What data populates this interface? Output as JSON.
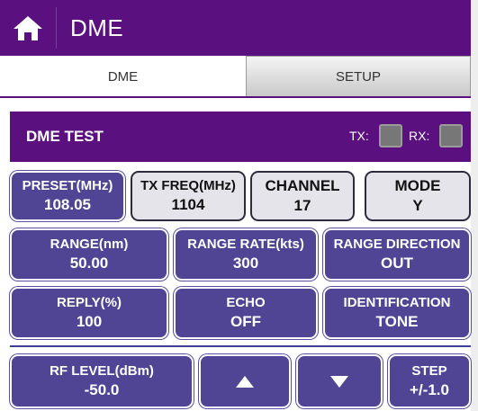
{
  "app": {
    "title": "DME"
  },
  "tabs": [
    {
      "label": "DME",
      "active": true
    },
    {
      "label": "SETUP",
      "active": false
    }
  ],
  "panel": {
    "title": "DME TEST",
    "tx_label": "TX:",
    "rx_label": "RX:"
  },
  "params": {
    "preset": {
      "label": "PRESET(MHz)",
      "value": "108.05"
    },
    "tx_freq": {
      "label": "TX FREQ(MHz)",
      "value": "1104"
    },
    "channel": {
      "label": "CHANNEL",
      "value": "17"
    },
    "mode": {
      "label": "MODE",
      "value": "Y"
    },
    "range": {
      "label": "RANGE(nm)",
      "value": "50.00"
    },
    "range_rate": {
      "label": "RANGE RATE(kts)",
      "value": "300"
    },
    "range_direction": {
      "label": "RANGE DIRECTION",
      "value": "OUT"
    },
    "reply": {
      "label": "REPLY(%)",
      "value": "100"
    },
    "echo": {
      "label": "ECHO",
      "value": "OFF"
    },
    "identification": {
      "label": "IDENTIFICATION",
      "value": "TONE"
    },
    "rf_level": {
      "label": "RF LEVEL(dBm)",
      "value": "-50.0"
    },
    "step": {
      "label": "STEP",
      "value": "+/-1.0"
    }
  },
  "colors": {
    "brand_purple": "#5b1080",
    "button_blue": "#504595",
    "indicator_off": "#777777"
  }
}
